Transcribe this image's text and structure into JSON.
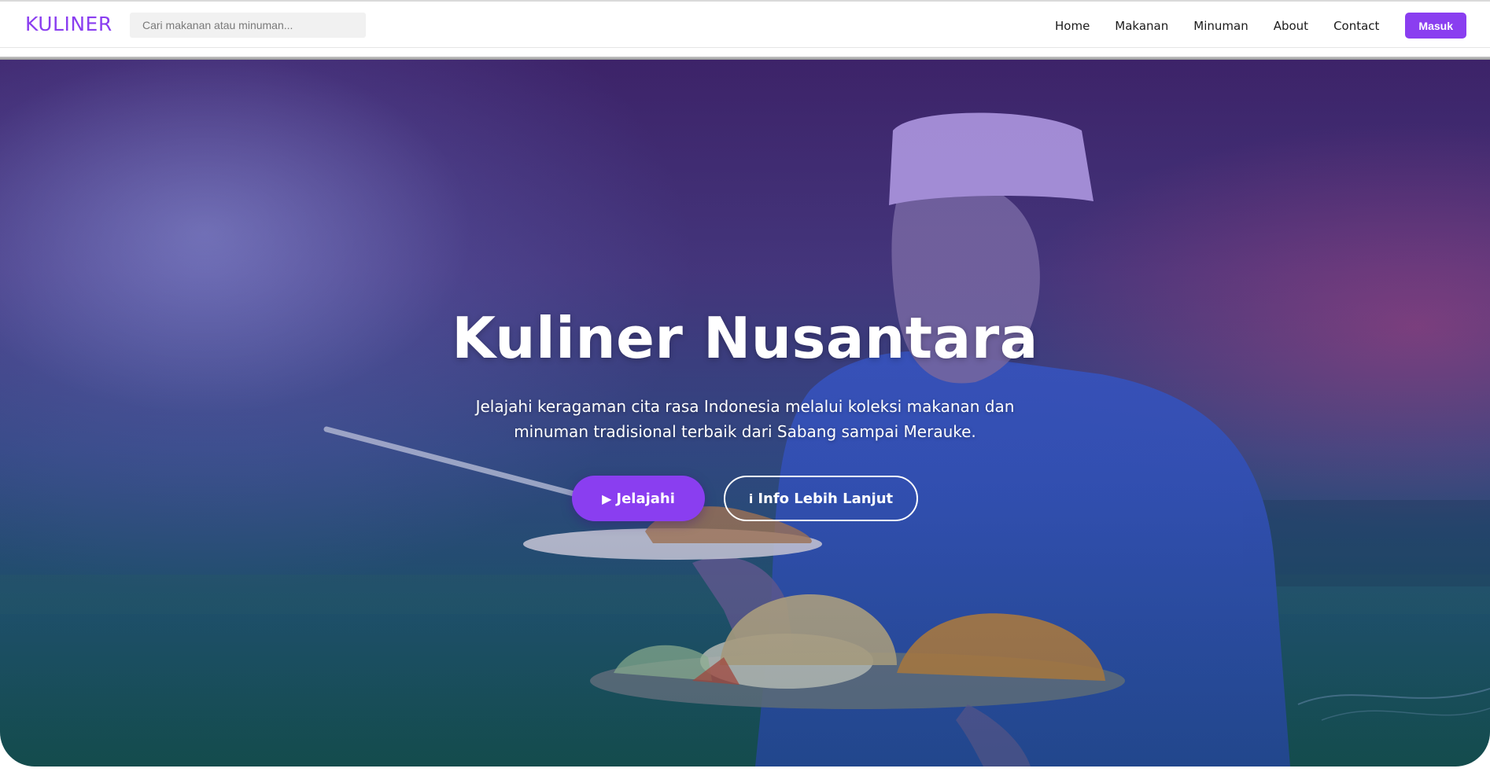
{
  "navbar": {
    "logo": "KULINER",
    "search_placeholder": "Cari makanan atau minuman...",
    "links": [
      "Home",
      "Makanan",
      "Minuman",
      "About",
      "Contact"
    ],
    "login_label": "Masuk"
  },
  "hero": {
    "title": "Kuliner Nusantara",
    "subtitle": "Jelajahi keragaman cita rasa Indonesia melalui koleksi makanan dan minuman tradisional terbaik dari Sabang sampai Merauke.",
    "primary_button": {
      "icon": "▶",
      "label": "Jelajahi"
    },
    "secondary_button": {
      "icon": "i",
      "label": "Info Lebih Lanjut"
    },
    "background_image": "chef-holding-plates-of-food"
  },
  "colors": {
    "accent": "#8a3ef0",
    "white": "#ffffff"
  }
}
